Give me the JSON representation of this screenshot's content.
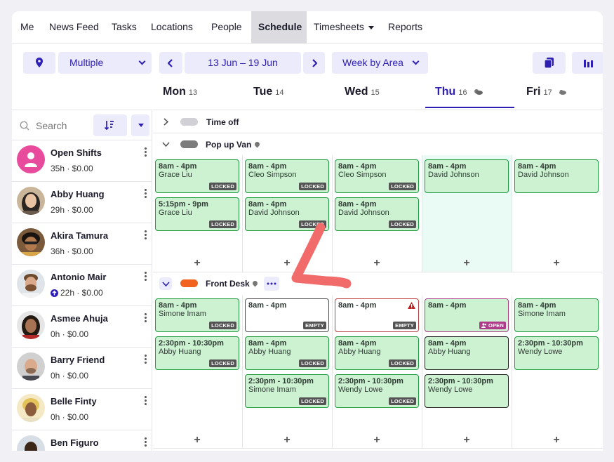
{
  "nav": {
    "items": [
      "Me",
      "News Feed",
      "Tasks",
      "Locations",
      "People",
      "Schedule",
      "Timesheets",
      "Reports"
    ],
    "active": "Schedule"
  },
  "toolbar": {
    "location_value": "Multiple",
    "date_range": "13 Jun – 19 Jun",
    "view_mode": "Week by Area"
  },
  "days": [
    {
      "name": "Mon",
      "num": "13"
    },
    {
      "name": "Tue",
      "num": "14"
    },
    {
      "name": "Wed",
      "num": "15"
    },
    {
      "name": "Thu",
      "num": "16"
    },
    {
      "name": "Fri",
      "num": "17"
    }
  ],
  "sidebar": {
    "search_placeholder": "Search",
    "people": [
      {
        "name": "Open Shifts",
        "hours": "35h · $0.00"
      },
      {
        "name": "Abby Huang",
        "hours": "29h · $0.00"
      },
      {
        "name": "Akira Tamura",
        "hours": "36h · $0.00"
      },
      {
        "name": "Antonio Mair",
        "hours": "22h · $0.00"
      },
      {
        "name": "Asmee Ahuja",
        "hours": "0h · $0.00"
      },
      {
        "name": "Barry Friend",
        "hours": "0h · $0.00"
      },
      {
        "name": "Belle Finty",
        "hours": "0h · $0.00"
      },
      {
        "name": "Ben Figuro",
        "hours": ""
      }
    ]
  },
  "groups": {
    "time_off": "Time off",
    "popup_van": "Pop up Van",
    "front_desk": "Front Desk"
  },
  "colors": {
    "accent": "#2d1fb4",
    "shift_bg": "#ccf2d2",
    "shift_border": "#1f9a3f",
    "front_desk": "#f0621e",
    "open_badge": "#b03a8a",
    "annotation": "#f26b6b"
  },
  "shifts": {
    "van": [
      [
        {
          "time": "8am - 4pm",
          "name": "Grace Liu",
          "badge": "LOCKED"
        },
        {
          "time": "5:15pm - 9pm",
          "name": "Grace Liu",
          "badge": "LOCKED"
        }
      ],
      [
        {
          "time": "8am - 4pm",
          "name": "Cleo Simpson",
          "badge": "LOCKED"
        },
        {
          "time": "8am - 4pm",
          "name": "David Johnson",
          "badge": "LOCKED"
        }
      ],
      [
        {
          "time": "8am - 4pm",
          "name": "Cleo Simpson",
          "badge": "LOCKED"
        },
        {
          "time": "8am - 4pm",
          "name": "David Johnson",
          "badge": "LOCKED"
        }
      ],
      [
        {
          "time": "8am - 4pm",
          "name": "David Johnson"
        }
      ],
      [
        {
          "time": "8am - 4pm",
          "name": "David Johnson"
        }
      ]
    ],
    "desk": [
      [
        {
          "time": "8am - 4pm",
          "name": "Simone Imam",
          "badge": "LOCKED"
        },
        {
          "time": "2:30pm - 10:30pm",
          "name": "Abby Huang",
          "badge": "LOCKED"
        }
      ],
      [
        {
          "time": "8am - 4pm",
          "name": "",
          "badge": "EMPTY"
        },
        {
          "time": "8am - 4pm",
          "name": "Abby Huang",
          "badge": "LOCKED"
        },
        {
          "time": "2:30pm - 10:30pm",
          "name": "Simone Imam",
          "badge": "LOCKED"
        }
      ],
      [
        {
          "time": "8am - 4pm",
          "name": "",
          "badge": "EMPTY"
        },
        {
          "time": "8am - 4pm",
          "name": "Abby Huang",
          "badge": "LOCKED"
        },
        {
          "time": "2:30pm - 10:30pm",
          "name": "Wendy Lowe",
          "badge": "LOCKED"
        }
      ],
      [
        {
          "time": "8am - 4pm",
          "name": "",
          "badge": "OPEN"
        },
        {
          "time": "8am - 4pm",
          "name": "Abby Huang"
        },
        {
          "time": "2:30pm - 10:30pm",
          "name": "Wendy Lowe"
        }
      ],
      [
        {
          "time": "8am - 4pm",
          "name": "Simone Imam"
        },
        {
          "time": "2:30pm - 10:30pm",
          "name": "Wendy Lowe"
        }
      ]
    ]
  }
}
